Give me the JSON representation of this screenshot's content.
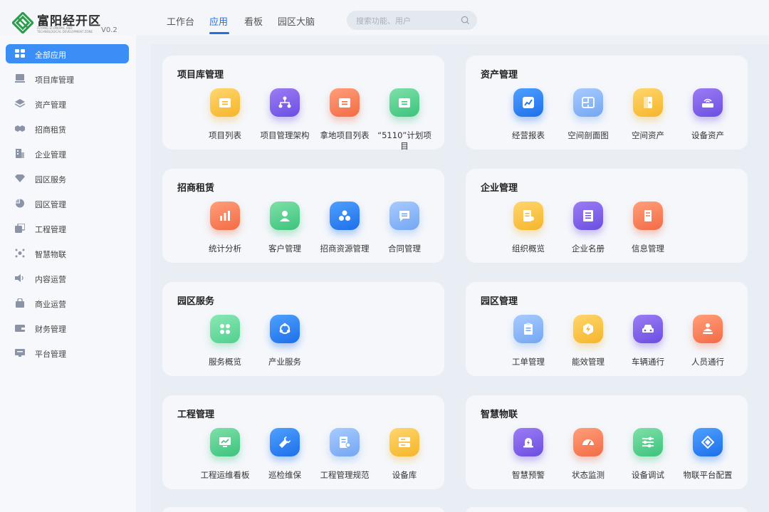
{
  "header": {
    "logo_name": "富阳经开区",
    "logo_subtitle": "FUYANG ECONOMIC AND TECHNOLOGICAL DEVELOPMENT ZONE",
    "version": "V0.2",
    "tabs": [
      {
        "label": "工作台",
        "active": false
      },
      {
        "label": "应用",
        "active": true
      },
      {
        "label": "看板",
        "active": false
      },
      {
        "label": "园区大脑",
        "active": false
      }
    ],
    "search_placeholder": "搜索功能、用户",
    "accent_color": "#1f6fe5"
  },
  "sidebar": {
    "items": [
      {
        "label": "全部应用",
        "icon": "grid-icon",
        "active": true
      },
      {
        "label": "项目库管理",
        "icon": "monitor-icon",
        "active": false
      },
      {
        "label": "资产管理",
        "icon": "layers-icon",
        "active": false
      },
      {
        "label": "招商租赁",
        "icon": "handshake-icon",
        "active": false
      },
      {
        "label": "企业管理",
        "icon": "building-icon",
        "active": false
      },
      {
        "label": "园区服务",
        "icon": "diamond-icon",
        "active": false
      },
      {
        "label": "园区管理",
        "icon": "pie-icon",
        "active": false
      },
      {
        "label": "工程管理",
        "icon": "copy-icon",
        "active": false
      },
      {
        "label": "智慧物联",
        "icon": "network-icon",
        "active": false
      },
      {
        "label": "内容运营",
        "icon": "speaker-icon",
        "active": false
      },
      {
        "label": "商业运营",
        "icon": "store-icon",
        "active": false
      },
      {
        "label": "财务管理",
        "icon": "wallet-icon",
        "active": false
      },
      {
        "label": "平台管理",
        "icon": "platform-icon",
        "active": false
      }
    ]
  },
  "cards": [
    {
      "title": "项目库管理",
      "apps": [
        {
          "label": "项目列表",
          "icon": "folder-icon",
          "color": "yellow"
        },
        {
          "label": "项目管理架构",
          "icon": "hierarchy-icon",
          "color": "purple"
        },
        {
          "label": "拿地项目列表",
          "icon": "folder-icon",
          "color": "orange"
        },
        {
          "label": "“5110”计划项目",
          "icon": "folder-icon",
          "color": "green"
        }
      ]
    },
    {
      "title": "资产管理",
      "apps": [
        {
          "label": "经营报表",
          "icon": "trend-chart-icon",
          "color": "blue"
        },
        {
          "label": "空间剖面图",
          "icon": "floorplan-icon",
          "color": "lightblue"
        },
        {
          "label": "空间资产",
          "icon": "door-icon",
          "color": "yellow"
        },
        {
          "label": "设备资产",
          "icon": "router-icon",
          "color": "purple"
        }
      ]
    },
    {
      "title": "招商租赁",
      "apps": [
        {
          "label": "统计分析",
          "icon": "bar-chart-icon",
          "color": "orange"
        },
        {
          "label": "客户管理",
          "icon": "user-icon",
          "color": "green"
        },
        {
          "label": "招商资源管理",
          "icon": "resources-icon",
          "color": "blue"
        },
        {
          "label": "合同管理",
          "icon": "contract-icon",
          "color": "lightblue"
        }
      ]
    },
    {
      "title": "企业管理",
      "apps": [
        {
          "label": "组织概览",
          "icon": "org-doc-icon",
          "color": "yellow"
        },
        {
          "label": "企业名册",
          "icon": "roster-icon",
          "color": "purple"
        },
        {
          "label": "信息管理",
          "icon": "building-icon",
          "color": "orange"
        }
      ]
    },
    {
      "title": "园区服务",
      "apps": [
        {
          "label": "服务概览",
          "icon": "grid-icon",
          "color": "lightgreen"
        },
        {
          "label": "产业服务",
          "icon": "cycle-icon",
          "color": "blue"
        }
      ]
    },
    {
      "title": "园区管理",
      "apps": [
        {
          "label": "工单管理",
          "icon": "clipboard-icon",
          "color": "lightblue"
        },
        {
          "label": "能效管理",
          "icon": "energy-icon",
          "color": "yellow"
        },
        {
          "label": "车辆通行",
          "icon": "car-icon",
          "color": "purple"
        },
        {
          "label": "人员通行",
          "icon": "person-pass-icon",
          "color": "orange"
        }
      ]
    },
    {
      "title": "工程管理",
      "apps": [
        {
          "label": "工程运维看板",
          "icon": "monitor-chart-icon",
          "color": "green"
        },
        {
          "label": "巡检维保",
          "icon": "wrench-icon",
          "color": "blue"
        },
        {
          "label": "工程管理规范",
          "icon": "document-gear-icon",
          "color": "lightblue"
        },
        {
          "label": "设备库",
          "icon": "storage-icon",
          "color": "yellow"
        }
      ]
    },
    {
      "title": "智慧物联",
      "apps": [
        {
          "label": "智慧预警",
          "icon": "alarm-icon",
          "color": "purple"
        },
        {
          "label": "状态监测",
          "icon": "gauge-icon",
          "color": "orange"
        },
        {
          "label": "设备调试",
          "icon": "sliders-icon",
          "color": "green"
        },
        {
          "label": "物联平台配置",
          "icon": "iot-icon",
          "color": "blue"
        }
      ]
    }
  ]
}
